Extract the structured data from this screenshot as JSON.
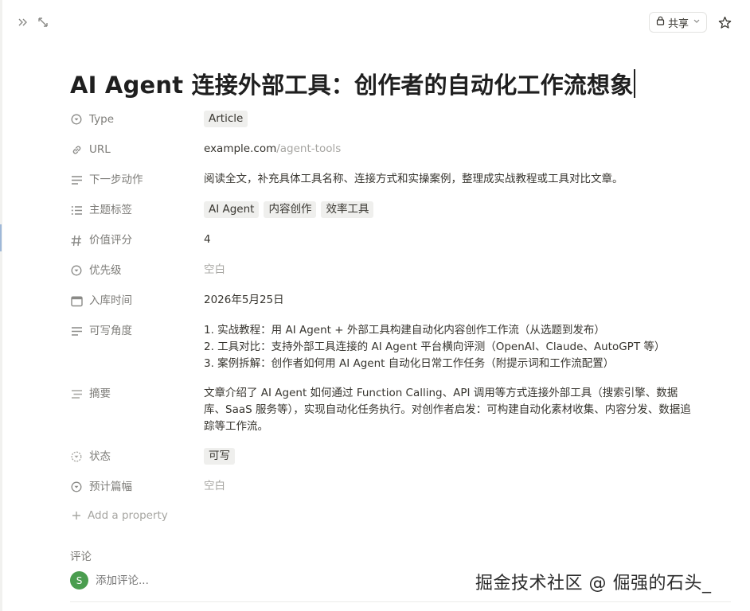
{
  "topbar": {
    "left_icons": [
      "collapse-double-chevron-icon",
      "expand-arrows-icon"
    ],
    "share_label": "共享",
    "star_icon": "star-icon"
  },
  "page": {
    "title": "AI Agent 连接外部工具：创作者的自动化工作流想象"
  },
  "properties": {
    "type": {
      "label": "Type",
      "icon": "select-icon",
      "value": "Article"
    },
    "url": {
      "label": "URL",
      "icon": "link-icon",
      "host": "example.com",
      "path": "/agent-tools"
    },
    "next_action": {
      "label": "下一步动作",
      "icon": "text-icon",
      "value": "阅读全文，补充具体工具名称、连接方式和实操案例，整理成实战教程或工具对比文章。"
    },
    "topic_tags": {
      "label": "主题标签",
      "icon": "list-icon",
      "tags": [
        "AI Agent",
        "内容创作",
        "效率工具"
      ]
    },
    "value_score": {
      "label": "价值评分",
      "icon": "number-icon",
      "value": "4"
    },
    "priority": {
      "label": "优先级",
      "icon": "select-icon",
      "value": "空白"
    },
    "added_date": {
      "label": "入库时间",
      "icon": "calendar-icon",
      "value": "2026年5月25日"
    },
    "angles": {
      "label": "可写角度",
      "icon": "text-icon",
      "lines": [
        "1. 实战教程：用 AI Agent + 外部工具构建自动化内容创作工作流（从选题到发布）",
        "2. 工具对比：支持外部工具连接的 AI Agent 平台横向评测（OpenAI、Claude、AutoGPT 等）",
        "3. 案例拆解：创作者如何用 AI Agent 自动化日常工作任务（附提示词和工作流配置）"
      ]
    },
    "summary": {
      "label": "摘要",
      "icon": "ai-summary-icon",
      "value": "文章介绍了 AI Agent 如何通过 Function Calling、API 调用等方式连接外部工具（搜索引擎、数据库、SaaS 服务等），实现自动化任务执行。对创作者启发：可构建自动化素材收集、内容分发、数据追踪等工作流。"
    },
    "status": {
      "label": "状态",
      "icon": "status-icon",
      "value": "可写"
    },
    "estimated_length": {
      "label": "预计篇幅",
      "icon": "select-icon",
      "value": "空白"
    }
  },
  "add_property_label": "Add a property",
  "comments": {
    "label": "评论",
    "avatar_initial": "S",
    "placeholder": "添加评论..."
  },
  "watermark": "掘金技术社区 @ 倔强的石头_"
}
